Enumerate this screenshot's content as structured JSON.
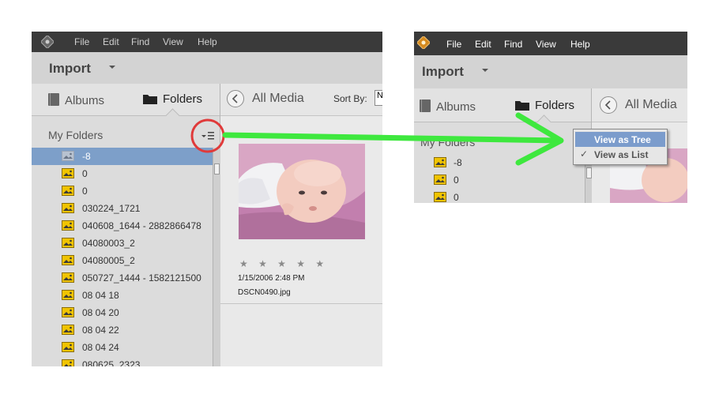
{
  "left": {
    "menubar": [
      "File",
      "Edit",
      "Find",
      "View",
      "Help"
    ],
    "import_label": "Import",
    "tabs": {
      "albums": "Albums",
      "folders": "Folders"
    },
    "my_folders": "My Folders",
    "folders": [
      "-8",
      "0",
      "0",
      "030224_1721",
      "040608_1644 - 2882866478",
      "04080003_2",
      "04080005_2",
      "050727_1444 - 1582121500",
      "08 04 18",
      "08 04 20",
      "08 04 22",
      "08 04 24",
      "080625_2323"
    ],
    "selected_folder_index": 0,
    "all_media": "All Media",
    "sort_by": "Sort By:",
    "sort_value": "N",
    "media": {
      "rating": "★ ★ ★ ★ ★",
      "date": "1/15/2006 2:48 PM",
      "filename": "DSCN0490.jpg"
    }
  },
  "right": {
    "menubar": [
      "File",
      "Edit",
      "Find",
      "View",
      "Help"
    ],
    "import_label": "Import",
    "tabs": {
      "albums": "Albums",
      "folders": "Folders"
    },
    "my_folders": "My Folders",
    "folders": [
      "-8",
      "0",
      "0"
    ],
    "all_media": "All Media",
    "view_menu": {
      "view_as_tree": "View as Tree",
      "view_as_list": "View as List",
      "checked": "✓"
    }
  },
  "colors": {
    "selection": "#7d9fc9",
    "menu_highlight": "#7b9ccc",
    "annotation_circle": "#e03a3a",
    "annotation_arrow": "#3ee83e"
  }
}
